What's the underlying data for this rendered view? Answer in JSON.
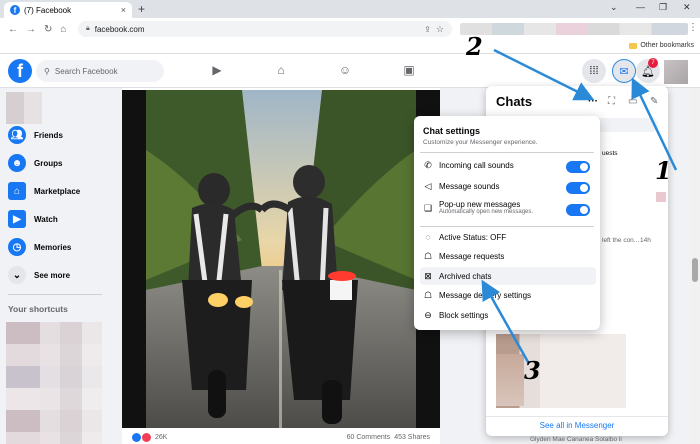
{
  "browser": {
    "tab_title": "(7) Facebook",
    "tab_close": "×",
    "new_tab": "+",
    "window_controls": [
      "⌄",
      "—",
      "❐",
      "✕"
    ],
    "url": "facebook.com",
    "bookmarks_label": "Other bookmarks",
    "nav": [
      "←",
      "→",
      "↻",
      "⌂"
    ]
  },
  "fb": {
    "logo": "f",
    "search_placeholder": "Search Facebook",
    "notif_count": "7"
  },
  "sidebar": {
    "items": [
      {
        "label": "Friends",
        "icon": "friends-icon",
        "color": "#1877f2"
      },
      {
        "label": "Groups",
        "icon": "groups-icon",
        "color": "#1877f2"
      },
      {
        "label": "Marketplace",
        "icon": "marketplace-icon",
        "color": "#1877f2"
      },
      {
        "label": "Watch",
        "icon": "watch-icon",
        "color": "#1877f2"
      },
      {
        "label": "Memories",
        "icon": "memories-icon",
        "color": "#1877f2"
      },
      {
        "label": "See more",
        "icon": "chevron-down-icon",
        "color": "#e4e6eb"
      }
    ],
    "shortcuts_title": "Your shortcuts"
  },
  "post": {
    "reactions": "26K",
    "comments": "60 Comments",
    "shares": "453 Shares"
  },
  "chats": {
    "title": "Chats",
    "more": "···",
    "see_all": "See all in Messenger",
    "fragment_requests": "uests",
    "fragment_left": "left the con...",
    "fragment_time": "14h",
    "bottom_name": "Glyden Mae Cananea Sotalbo li"
  },
  "chat_settings": {
    "title": "Chat settings",
    "subtitle": "Customize your Messenger experience.",
    "items": [
      {
        "label": "Incoming call sounds",
        "icon": "phone-icon",
        "toggle": true
      },
      {
        "label": "Message sounds",
        "icon": "speaker-icon",
        "toggle": true
      },
      {
        "label": "Pop-up new messages",
        "sub": "Automatically open new messages.",
        "icon": "chat-bubbles-icon",
        "toggle": true
      },
      {
        "label": "Active Status: OFF",
        "icon": "active-status-icon"
      },
      {
        "label": "Message requests",
        "icon": "message-requests-icon"
      },
      {
        "label": "Archived chats",
        "icon": "archive-icon"
      },
      {
        "label": "Message delivery settings",
        "icon": "delivery-icon"
      },
      {
        "label": "Block settings",
        "icon": "block-icon"
      }
    ]
  },
  "annotations": {
    "n1": "1",
    "n2": "2",
    "n3": "3",
    "arrow_color": "#2a8ad8"
  }
}
